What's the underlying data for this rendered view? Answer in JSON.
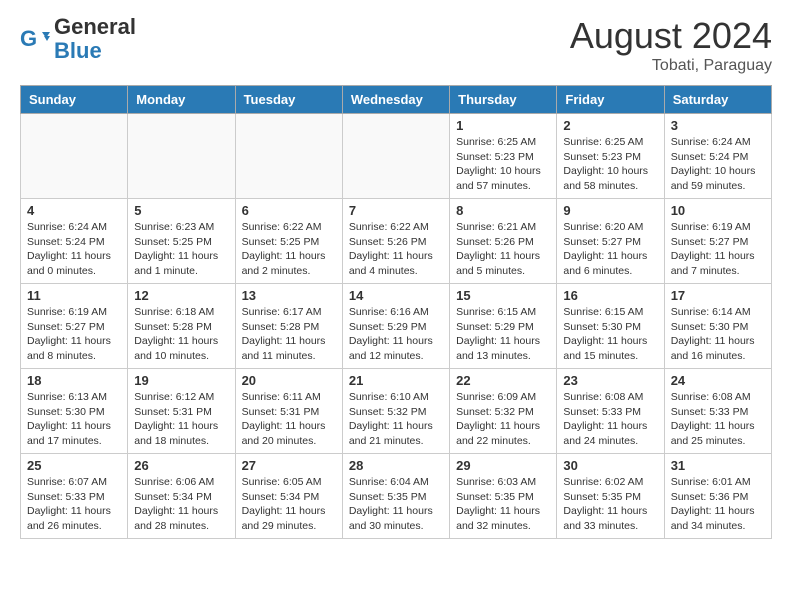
{
  "header": {
    "logo_line1": "General",
    "logo_line2": "Blue",
    "month_title": "August 2024",
    "location": "Tobati, Paraguay"
  },
  "weekdays": [
    "Sunday",
    "Monday",
    "Tuesday",
    "Wednesday",
    "Thursday",
    "Friday",
    "Saturday"
  ],
  "weeks": [
    [
      {
        "day": "",
        "info": ""
      },
      {
        "day": "",
        "info": ""
      },
      {
        "day": "",
        "info": ""
      },
      {
        "day": "",
        "info": ""
      },
      {
        "day": "1",
        "info": "Sunrise: 6:25 AM\nSunset: 5:23 PM\nDaylight: 10 hours\nand 57 minutes."
      },
      {
        "day": "2",
        "info": "Sunrise: 6:25 AM\nSunset: 5:23 PM\nDaylight: 10 hours\nand 58 minutes."
      },
      {
        "day": "3",
        "info": "Sunrise: 6:24 AM\nSunset: 5:24 PM\nDaylight: 10 hours\nand 59 minutes."
      }
    ],
    [
      {
        "day": "4",
        "info": "Sunrise: 6:24 AM\nSunset: 5:24 PM\nDaylight: 11 hours\nand 0 minutes."
      },
      {
        "day": "5",
        "info": "Sunrise: 6:23 AM\nSunset: 5:25 PM\nDaylight: 11 hours\nand 1 minute."
      },
      {
        "day": "6",
        "info": "Sunrise: 6:22 AM\nSunset: 5:25 PM\nDaylight: 11 hours\nand 2 minutes."
      },
      {
        "day": "7",
        "info": "Sunrise: 6:22 AM\nSunset: 5:26 PM\nDaylight: 11 hours\nand 4 minutes."
      },
      {
        "day": "8",
        "info": "Sunrise: 6:21 AM\nSunset: 5:26 PM\nDaylight: 11 hours\nand 5 minutes."
      },
      {
        "day": "9",
        "info": "Sunrise: 6:20 AM\nSunset: 5:27 PM\nDaylight: 11 hours\nand 6 minutes."
      },
      {
        "day": "10",
        "info": "Sunrise: 6:19 AM\nSunset: 5:27 PM\nDaylight: 11 hours\nand 7 minutes."
      }
    ],
    [
      {
        "day": "11",
        "info": "Sunrise: 6:19 AM\nSunset: 5:27 PM\nDaylight: 11 hours\nand 8 minutes."
      },
      {
        "day": "12",
        "info": "Sunrise: 6:18 AM\nSunset: 5:28 PM\nDaylight: 11 hours\nand 10 minutes."
      },
      {
        "day": "13",
        "info": "Sunrise: 6:17 AM\nSunset: 5:28 PM\nDaylight: 11 hours\nand 11 minutes."
      },
      {
        "day": "14",
        "info": "Sunrise: 6:16 AM\nSunset: 5:29 PM\nDaylight: 11 hours\nand 12 minutes."
      },
      {
        "day": "15",
        "info": "Sunrise: 6:15 AM\nSunset: 5:29 PM\nDaylight: 11 hours\nand 13 minutes."
      },
      {
        "day": "16",
        "info": "Sunrise: 6:15 AM\nSunset: 5:30 PM\nDaylight: 11 hours\nand 15 minutes."
      },
      {
        "day": "17",
        "info": "Sunrise: 6:14 AM\nSunset: 5:30 PM\nDaylight: 11 hours\nand 16 minutes."
      }
    ],
    [
      {
        "day": "18",
        "info": "Sunrise: 6:13 AM\nSunset: 5:30 PM\nDaylight: 11 hours\nand 17 minutes."
      },
      {
        "day": "19",
        "info": "Sunrise: 6:12 AM\nSunset: 5:31 PM\nDaylight: 11 hours\nand 18 minutes."
      },
      {
        "day": "20",
        "info": "Sunrise: 6:11 AM\nSunset: 5:31 PM\nDaylight: 11 hours\nand 20 minutes."
      },
      {
        "day": "21",
        "info": "Sunrise: 6:10 AM\nSunset: 5:32 PM\nDaylight: 11 hours\nand 21 minutes."
      },
      {
        "day": "22",
        "info": "Sunrise: 6:09 AM\nSunset: 5:32 PM\nDaylight: 11 hours\nand 22 minutes."
      },
      {
        "day": "23",
        "info": "Sunrise: 6:08 AM\nSunset: 5:33 PM\nDaylight: 11 hours\nand 24 minutes."
      },
      {
        "day": "24",
        "info": "Sunrise: 6:08 AM\nSunset: 5:33 PM\nDaylight: 11 hours\nand 25 minutes."
      }
    ],
    [
      {
        "day": "25",
        "info": "Sunrise: 6:07 AM\nSunset: 5:33 PM\nDaylight: 11 hours\nand 26 minutes."
      },
      {
        "day": "26",
        "info": "Sunrise: 6:06 AM\nSunset: 5:34 PM\nDaylight: 11 hours\nand 28 minutes."
      },
      {
        "day": "27",
        "info": "Sunrise: 6:05 AM\nSunset: 5:34 PM\nDaylight: 11 hours\nand 29 minutes."
      },
      {
        "day": "28",
        "info": "Sunrise: 6:04 AM\nSunset: 5:35 PM\nDaylight: 11 hours\nand 30 minutes."
      },
      {
        "day": "29",
        "info": "Sunrise: 6:03 AM\nSunset: 5:35 PM\nDaylight: 11 hours\nand 32 minutes."
      },
      {
        "day": "30",
        "info": "Sunrise: 6:02 AM\nSunset: 5:35 PM\nDaylight: 11 hours\nand 33 minutes."
      },
      {
        "day": "31",
        "info": "Sunrise: 6:01 AM\nSunset: 5:36 PM\nDaylight: 11 hours\nand 34 minutes."
      }
    ]
  ]
}
